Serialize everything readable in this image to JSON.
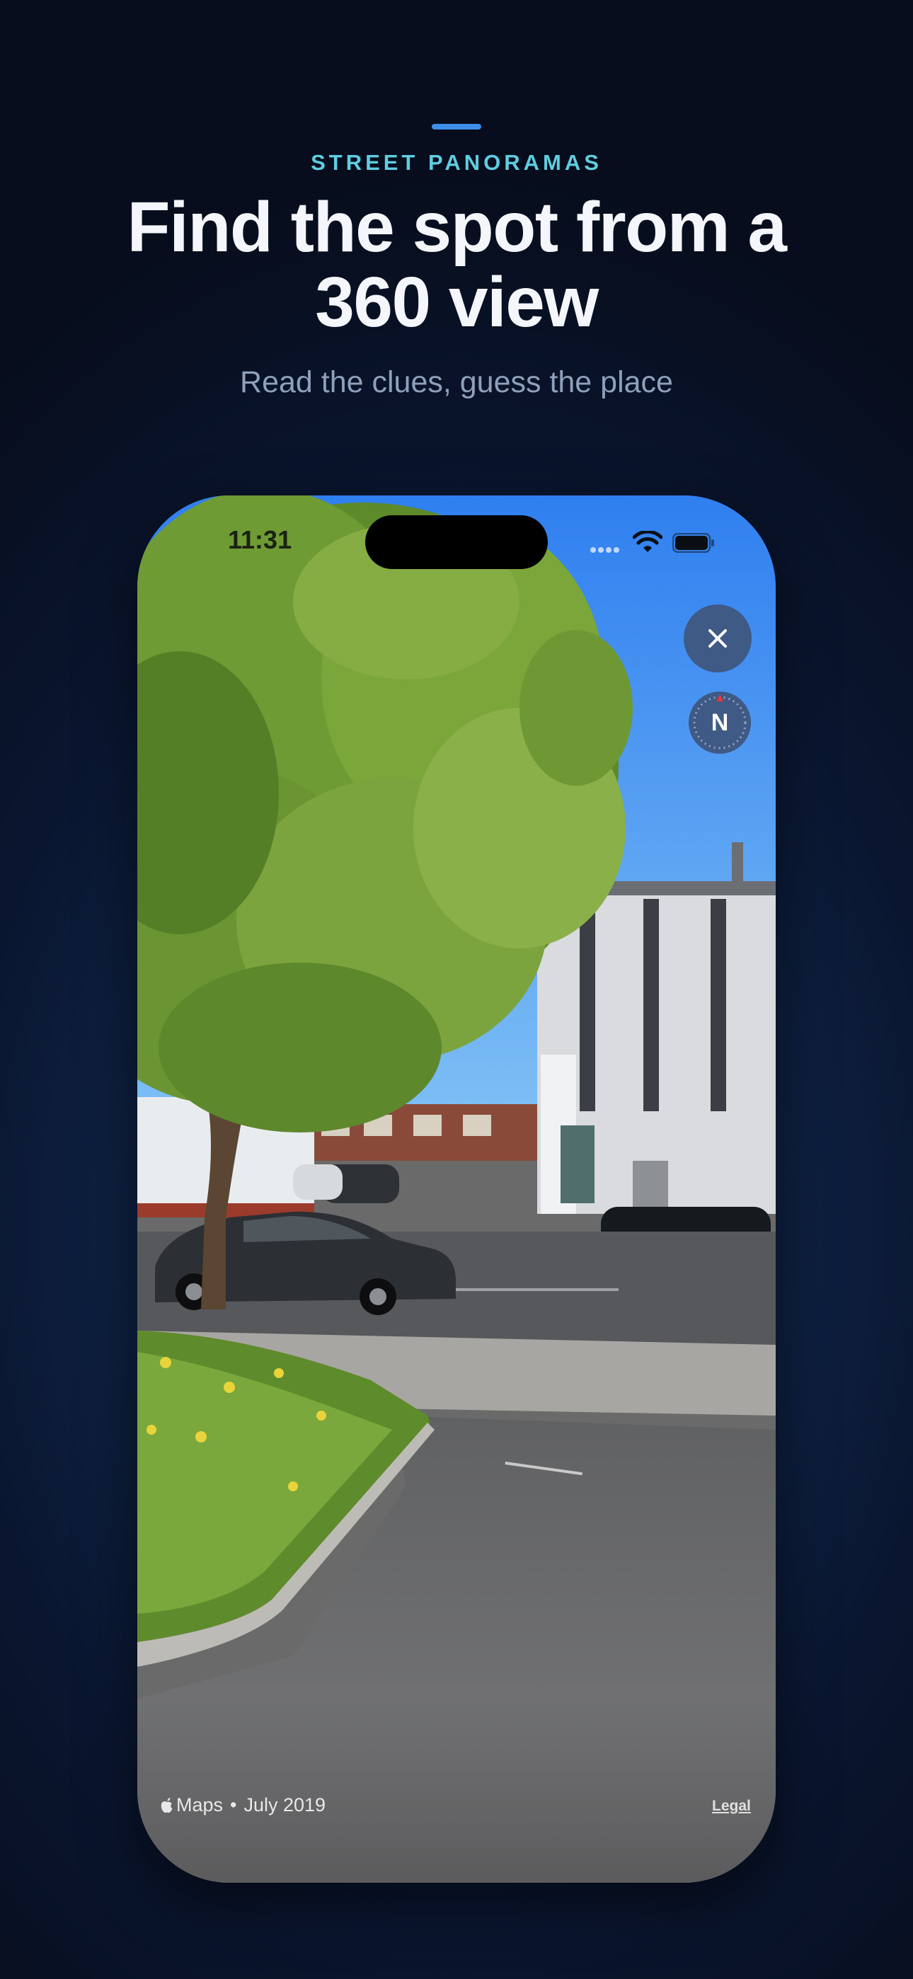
{
  "header": {
    "eyebrow": "STREET PANORAMAS",
    "headline": "Find the spot from a 360 view",
    "subhead": "Read the clues, guess the place"
  },
  "phone": {
    "status_bar": {
      "time": "11:31",
      "icons": [
        "cellular-signal-icon",
        "wifi-icon",
        "battery-icon"
      ]
    },
    "controls": {
      "close_icon": "close-icon",
      "compass_label": "N"
    },
    "attribution": {
      "provider": "Maps",
      "separator": "•",
      "date": "July 2019",
      "legal_label": "Legal"
    }
  },
  "colors": {
    "background": "#0a1630",
    "accent_bar": "#3d8ee8",
    "eyebrow": "#5fcde0",
    "subhead": "#8ea0bb",
    "control_fill": "#3f5a85",
    "compass_north": "#e23a3a"
  }
}
